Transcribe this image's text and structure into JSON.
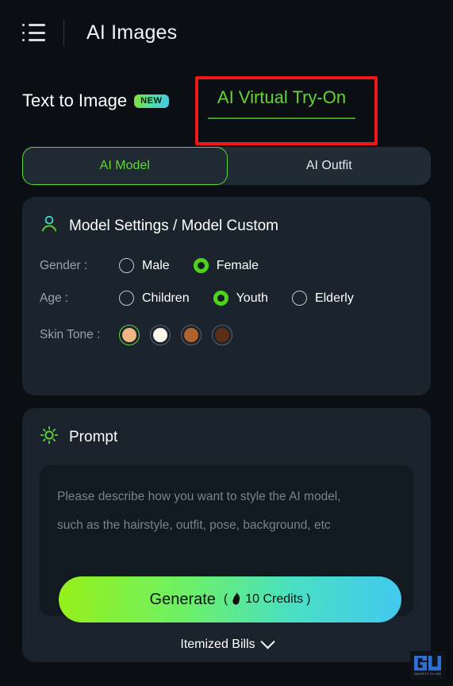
{
  "topbar": {
    "menu_icon": "list-menu-icon",
    "title": "AI Images"
  },
  "section_tabs": [
    {
      "label": "Text to Image",
      "badge": "NEW",
      "active": false
    },
    {
      "label": "AI Virtual Try-On",
      "badge": "",
      "active": true
    }
  ],
  "mode_tabs": [
    {
      "label": "AI Model",
      "active": true
    },
    {
      "label": "AI Outfit",
      "active": false
    }
  ],
  "model_card": {
    "icon": "person-icon",
    "title": "Model Settings / Model Custom",
    "gender": {
      "label": "Gender :",
      "options": [
        {
          "label": "Male",
          "selected": false
        },
        {
          "label": "Female",
          "selected": true
        }
      ]
    },
    "age": {
      "label": "Age :",
      "options": [
        {
          "label": "Children",
          "selected": false
        },
        {
          "label": "Youth",
          "selected": true
        },
        {
          "label": "Elderly",
          "selected": false
        }
      ]
    },
    "skin_tone": {
      "label": "Skin Tone :",
      "options": [
        {
          "name": "light-tan",
          "color": "#f1b683",
          "selected": true
        },
        {
          "name": "pale-cream",
          "color": "#fbf5eb",
          "selected": false
        },
        {
          "name": "medium-brown",
          "color": "#b0632c",
          "selected": false
        },
        {
          "name": "dark-brown",
          "color": "#5d2e17",
          "selected": false
        }
      ]
    }
  },
  "prompt_card": {
    "icon": "sun-brightness-icon",
    "title": "Prompt",
    "placeholder_line1": "Please describe how you want to style the AI model,",
    "placeholder_line2": "such as the hairstyle, outfit, pose, background, etc",
    "value": ""
  },
  "generate": {
    "label": "Generate",
    "credits_prefix": "(",
    "flame_icon": "flame-icon",
    "credits_text": "10 Credits",
    "credits_suffix": ")"
  },
  "itemized_bills": {
    "label": "Itemized Bills",
    "chevron": "chevron-down-icon"
  },
  "annotation": {
    "highlight_color": "#ef1717",
    "target": "AI Virtual Try-On"
  },
  "watermark": {
    "mark": "GU",
    "caption": "GADGETS TO USE"
  },
  "colors": {
    "page_bg": "#0b0e12",
    "card_bg": "#1b242d",
    "accent_green": "#63d636",
    "accent_cyan": "#42c8f0"
  }
}
